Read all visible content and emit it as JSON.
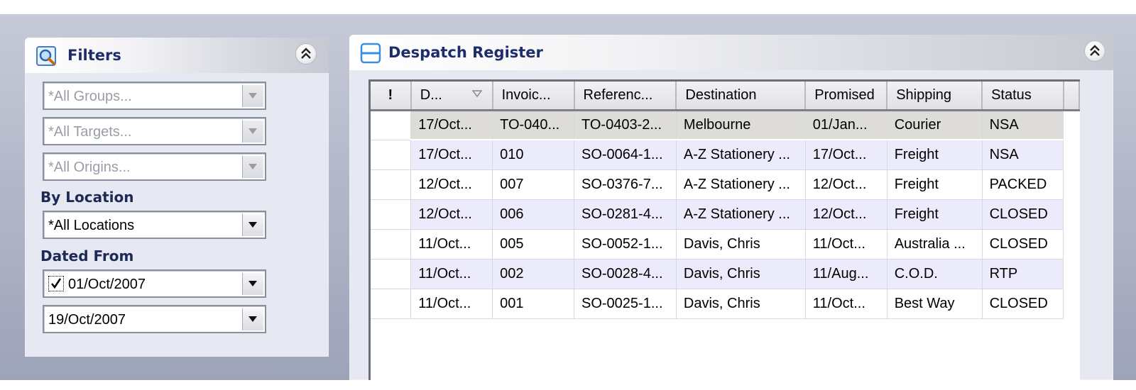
{
  "filters": {
    "title": "Filters",
    "groups": {
      "value": "*All Groups..."
    },
    "targets": {
      "value": "*All Targets..."
    },
    "origins": {
      "value": "*All Origins..."
    },
    "location_label": "By Location",
    "location": {
      "value": "*All Locations"
    },
    "dated_label": "Dated From",
    "date_from": {
      "value": "01/Oct/2007",
      "checked": true
    },
    "date_to": {
      "value": "19/Oct/2007"
    }
  },
  "register": {
    "title": "Despatch Register",
    "columns": [
      "!",
      "D...",
      "Invoic...",
      "Referenc...",
      "Destination",
      "Promised",
      "Shipping",
      "Status"
    ],
    "rows": [
      [
        "",
        "17/Oct...",
        "TO-040...",
        "TO-0403-2...",
        "Melbourne",
        "01/Jan...",
        "Courier",
        "NSA"
      ],
      [
        "",
        "17/Oct...",
        "010",
        "SO-0064-1...",
        "A-Z Stationery ...",
        "17/Oct...",
        "Freight",
        "NSA"
      ],
      [
        "",
        "12/Oct...",
        "007",
        "SO-0376-7...",
        "A-Z Stationery ...",
        "12/Oct...",
        "Freight",
        "PACKED"
      ],
      [
        "",
        "12/Oct...",
        "006",
        "SO-0281-4...",
        "A-Z Stationery ...",
        "12/Oct...",
        "Freight",
        "CLOSED"
      ],
      [
        "",
        "11/Oct...",
        "005",
        "SO-0052-1...",
        "Davis, Chris",
        "11/Oct...",
        "Australia ...",
        "CLOSED"
      ],
      [
        "",
        "11/Oct...",
        "002",
        "SO-0028-4...",
        "Davis, Chris",
        "11/Aug...",
        "C.O.D.",
        "RTP"
      ],
      [
        "",
        "11/Oct...",
        "001",
        "SO-0025-1...",
        "Davis, Chris",
        "11/Oct...",
        "Best Way",
        "CLOSED"
      ]
    ],
    "selected_row": 0
  },
  "colors": {
    "title_text": "#1d2c6b",
    "panel_bg": "#e6e9f1",
    "row_alt": "#ecebfb",
    "row_selected": "#dedcd8"
  },
  "icons": {
    "filters": "magnifier-icon",
    "register": "register-icon",
    "collapse": "chevron-double-up-icon",
    "dropdown": "chevron-down-icon",
    "sort": "sort-down-icon"
  }
}
